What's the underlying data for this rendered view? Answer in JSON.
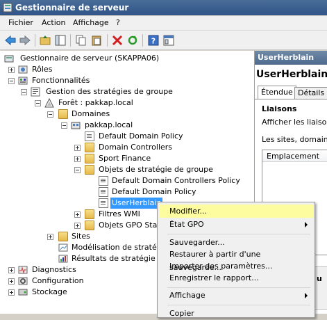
{
  "window": {
    "title": "Gestionnaire de serveur"
  },
  "menu": [
    "Fichier",
    "Action",
    "Affichage",
    "?"
  ],
  "tree": {
    "root": "Gestionnaire de serveur (SKAPPA06)",
    "roles": "Rôles",
    "features": "Fonctionnalités",
    "gpm": "Gestion des stratégies de groupe",
    "forest": "Forêt : pakkap.local",
    "domains": "Domaines",
    "domain": "pakkap.local",
    "default_domain_policy": "Default Domain Policy",
    "domain_controllers": "Domain Controllers",
    "sport_finance": "Sport Finance",
    "gpo_objects": "Objets de stratégie de groupe",
    "gpo_ddcp": "Default Domain Controllers Policy",
    "gpo_ddp": "Default Domain Policy",
    "gpo_user": "UserHerblain",
    "wmi_filters": "Filtres WMI",
    "starter_gpo": "Objets GPO Start",
    "sites": "Sites",
    "modeling": "Modélisation de stratégi",
    "results": "Résultats de stratégie de",
    "diagnostics": "Diagnostics",
    "configuration": "Configuration",
    "storage": "Stockage"
  },
  "right_panel": {
    "header": "UserHerblain",
    "title": "UserHerblain",
    "tabs": [
      "Étendue",
      "Détails"
    ],
    "section": "Liaisons",
    "show_links": "Afficher les liaisons",
    "sites_text": "Les sites, domaines",
    "column_location": "Emplacement",
    "bottom_partial": "u"
  },
  "context_menu": {
    "modify": "Modifier...",
    "gpo_state": "État GPO",
    "backup": "Sauvegarder...",
    "restore": "Restaurer à partir d'une sauvegarde...",
    "import": "Importer des paramètres...",
    "save_report": "Enregistrer le rapport...",
    "view": "Affichage",
    "copy": "Copier"
  },
  "colors": {
    "highlight": "#fdfda0",
    "selection": "#3399ff",
    "titlebar": "#2f5488"
  }
}
